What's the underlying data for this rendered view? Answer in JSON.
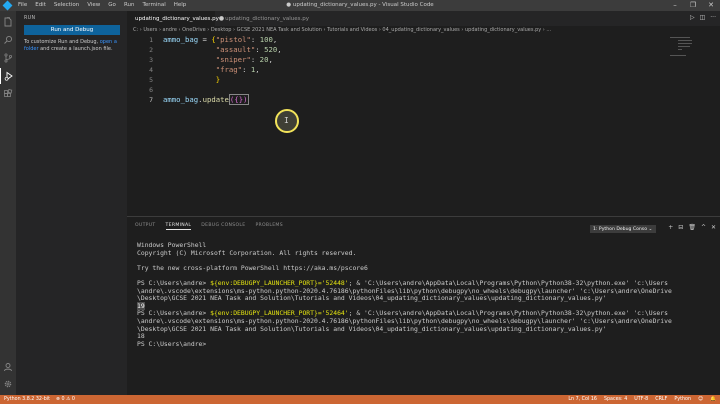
{
  "window": {
    "title": "● updating_dictionary_values.py - Visual Studio Code",
    "menu": [
      "File",
      "Edit",
      "Selection",
      "View",
      "Go",
      "Run",
      "Terminal",
      "Help"
    ],
    "controls": [
      "–",
      "❐",
      "✕"
    ]
  },
  "sidebar": {
    "title": "RUN",
    "run_button": "Run and Debug",
    "desc_before": "To customize Run and Debug, ",
    "desc_link": "open a folder",
    "desc_after": " and create a launch.json file."
  },
  "tabs": {
    "active": "updating_dictionary_values.py",
    "active_close": "●",
    "inactive": "updating_dictionary_values.py"
  },
  "breadcrumb": "C: › Users › andre › OneDrive › Desktop › GCSE 2021 NEA Task and Solution › Tutorials and Videos › 04_updating_dictionary_values › updating_dictionary_values.py › ...",
  "editor": {
    "line_numbers": [
      "1",
      "2",
      "3",
      "4",
      "5",
      "6",
      "7"
    ],
    "current_line": "7",
    "lines": {
      "l1_var": "ammo_bag",
      "l1_eq": " = ",
      "l1_brace": "{",
      "l1_key": "\"pistol\"",
      "l1_val": "100",
      "l2_key": "\"assault\"",
      "l2_val": "520",
      "l3_key": "\"sniper\"",
      "l3_val": "20",
      "l4_key": "\"frag\"",
      "l4_val": "1",
      "l5_brace": "}",
      "l7_var": "ammo_bag",
      "l7_fn": "update",
      "l7_parens": "({})"
    }
  },
  "panel": {
    "tabs": [
      "OUTPUT",
      "TERMINAL",
      "DEBUG CONSOLE",
      "PROBLEMS"
    ],
    "active_tab": "TERMINAL",
    "terminal_select": "1: Python Debug Conso ⌄",
    "actions": [
      "+",
      "⊟",
      "🗑",
      "^",
      "✕"
    ]
  },
  "terminal": {
    "line1": "Windows PowerShell",
    "line2": "Copyright (C) Microsoft Corporation. All rights reserved.",
    "line3": "Try the new cross-platform PowerShell https://aka.ms/pscore6",
    "run1_prompt": "PS C:\\Users\\andre> ",
    "run1_env": "${env:DEBUGPY_LAUNCHER_PORT}='52448'",
    "run1_rest": "; & 'C:\\Users\\andre\\AppData\\Local\\Programs\\Python\\Python38-32\\python.exe' 'c:\\Users",
    "run1_l2": "\\andre\\.vscode\\extensions\\ms-python.python-2020.4.76186\\pythonFiles\\lib\\python\\debugpy\\no_wheels\\debugpy\\launcher' 'c:\\Users\\andre\\OneDrive",
    "run1_l3": "\\Desktop\\GCSE 2021 NEA Task and Solution\\Tutorials and Videos\\04_updating_dictionary_values\\updating_dictionary_values.py'",
    "out1": "19",
    "run2_prompt": "PS C:\\Users\\andre> ",
    "run2_env": "${env:DEBUGPY_LAUNCHER_PORT}='52464'",
    "run2_rest": "; & 'C:\\Users\\andre\\AppData\\Local\\Programs\\Python\\Python38-32\\python.exe' 'c:\\Users",
    "run2_l2": "\\andre\\.vscode\\extensions\\ms-python.python-2020.4.76186\\pythonFiles\\lib\\python\\debugpy\\no_wheels\\debugpy\\launcher' 'c:\\Users\\andre\\OneDrive",
    "run2_l3": "\\Desktop\\GCSE 2021 NEA Task and Solution\\Tutorials and Videos\\04_updating_dictionary_values\\updating_dictionary_values.py'",
    "out2": "18",
    "final_prompt": "PS C:\\Users\\andre> "
  },
  "statusbar": {
    "python": "Python 3.8.2 32-bit",
    "errors": "⊗ 0 ⚠ 0",
    "position": "Ln 7, Col 16",
    "spaces": "Spaces: 4",
    "encoding": "UTF-8",
    "eol": "CRLF",
    "language": "Python",
    "feedback": "☺",
    "bell": "🔔"
  },
  "colors": {
    "statusbar": "#cc6633",
    "run_button": "#0e639c",
    "cursor_halo": "#f2e35a"
  }
}
